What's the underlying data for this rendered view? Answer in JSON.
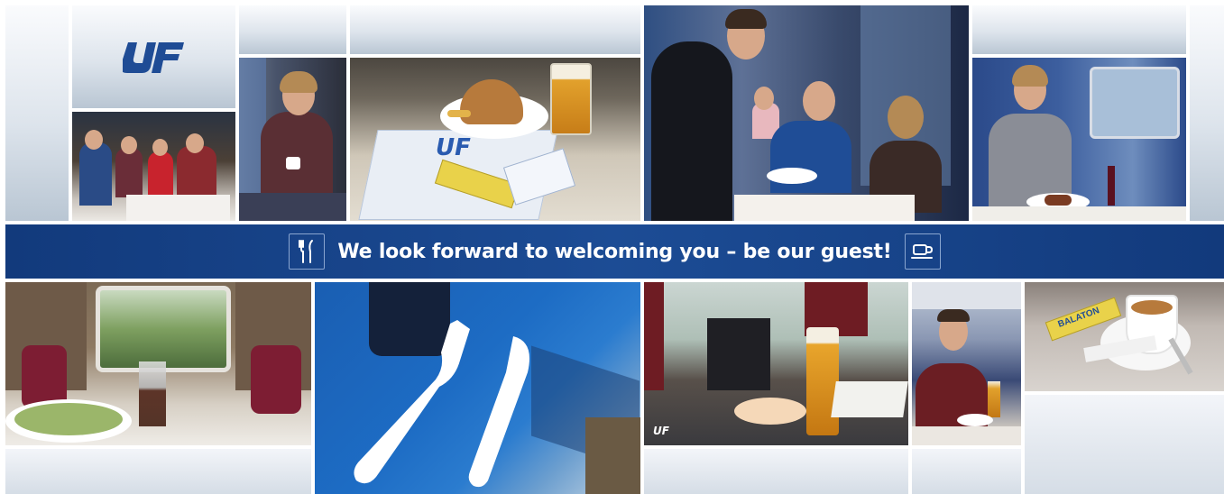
{
  "brand": {
    "logo_text": "UF",
    "logo_color": "#1f4c95"
  },
  "banner": {
    "text": "We look forward to welcoming you – be our guest!",
    "left_icon": "fork-knife-icon",
    "right_icon": "coffee-cup-icon",
    "background": "#1a4a91"
  },
  "photos": {
    "placemat_logo": "UF",
    "snack_brand": "BALATON",
    "table_sign_logo": "UF"
  }
}
